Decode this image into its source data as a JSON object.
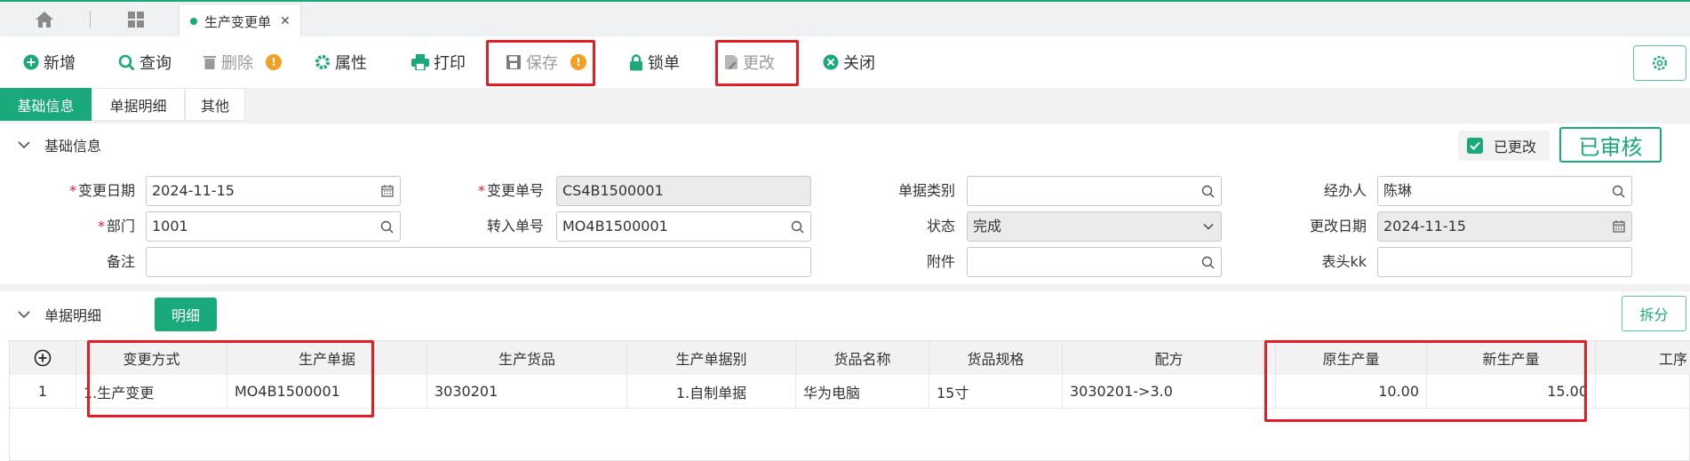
{
  "tabs": {
    "doc_tab": "生产变更单"
  },
  "toolbar": {
    "new": "新增",
    "query": "查询",
    "delete": "删除",
    "props": "属性",
    "print": "打印",
    "save": "保存",
    "lock": "锁单",
    "modify": "更改",
    "close": "关闭"
  },
  "section_tabs": [
    "基础信息",
    "单据明细",
    "其他"
  ],
  "basic": {
    "title": "基础信息",
    "changed_label": "已更改",
    "audit_stamp": "已审核",
    "labels": {
      "change_date": "变更日期",
      "change_no": "变更单号",
      "doc_type": "单据类别",
      "handler": "经办人",
      "dept": "部门",
      "import_no": "转入单号",
      "status": "状态",
      "modify_date": "更改日期",
      "remark": "备注",
      "attachment": "附件",
      "header_kk": "表头kk"
    },
    "values": {
      "change_date": "2024-11-15",
      "change_no": "CS4B1500001",
      "doc_type": "",
      "handler": "陈琳",
      "dept": "1001",
      "import_no": "MO4B1500001",
      "status": "完成",
      "modify_date": "2024-11-15",
      "remark": "",
      "attachment": "",
      "header_kk": ""
    }
  },
  "detail": {
    "title": "单据明细",
    "detail_btn": "明细",
    "split_btn": "拆分",
    "columns": [
      "变更方式",
      "生产单据",
      "生产货品",
      "生产单据别",
      "货品名称",
      "货品规格",
      "配方",
      "原生产量",
      "新生产量",
      "工序"
    ],
    "row": {
      "no": "1",
      "change_mode": "1.生产变更",
      "prod_doc": "MO4B1500001",
      "prod_item": "3030201",
      "prod_doc_type": "1.自制单据",
      "item_name": "华为电脑",
      "item_spec": "15寸",
      "formula": "3030201->3.0",
      "orig_qty": "10.00",
      "new_qty": "15.00"
    }
  },
  "colors": {
    "accent": "#19a97b",
    "highlight": "#e51c23",
    "warning": "#f0a023"
  }
}
